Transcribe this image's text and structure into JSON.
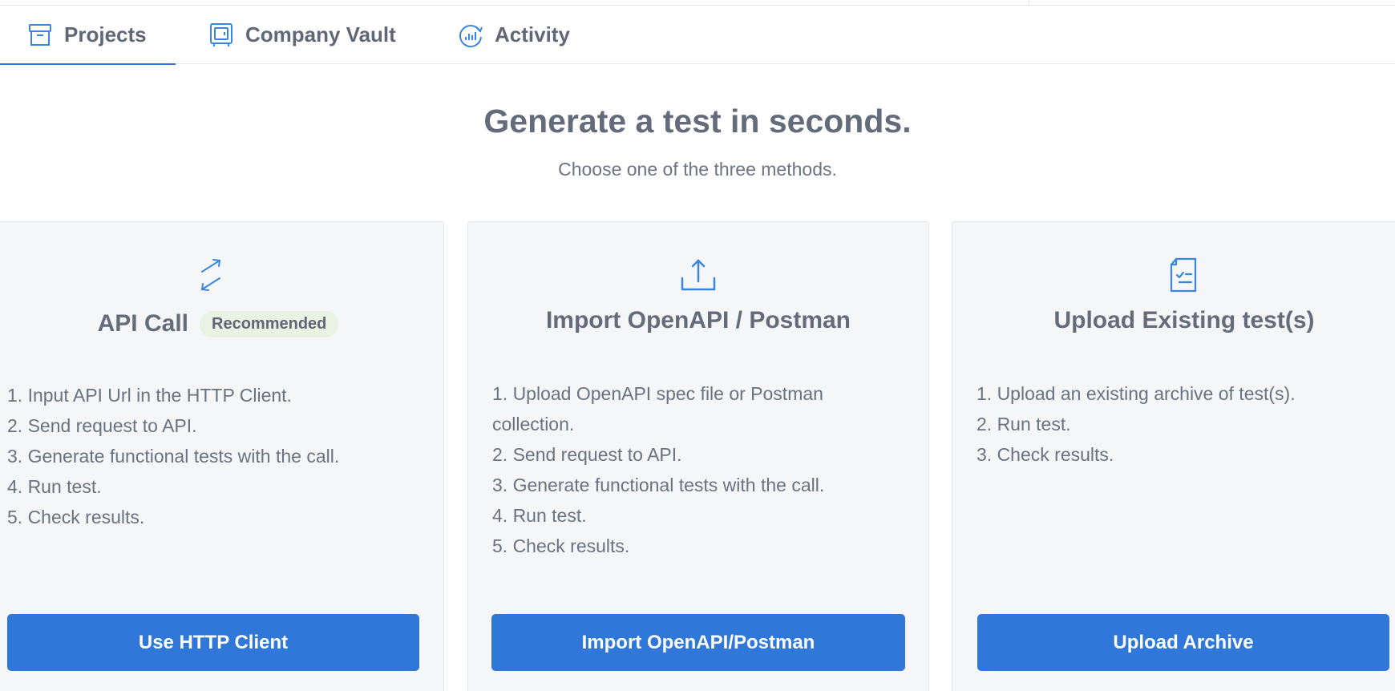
{
  "tabs": [
    {
      "label": "Projects",
      "icon": "archive-box-icon",
      "active": true
    },
    {
      "label": "Company Vault",
      "icon": "vault-icon",
      "active": false
    },
    {
      "label": "Activity",
      "icon": "activity-chart-icon",
      "active": false
    }
  ],
  "hero": {
    "title": "Generate a test in seconds.",
    "subtitle": "Choose one of the three methods."
  },
  "cards": [
    {
      "icon": "arrows-diagonal-icon",
      "title": "API Call",
      "badge": "Recommended",
      "steps": [
        "1. Input API Url in the HTTP Client.",
        "2. Send request to API.",
        "3. Generate functional tests with the call.",
        "4. Run test.",
        "5. Check results."
      ],
      "button": "Use HTTP Client"
    },
    {
      "icon": "upload-icon",
      "title": "Import OpenAPI / Postman",
      "steps": [
        "1. Upload OpenAPI spec file or Postman",
        "collection.",
        "2. Send request to API.",
        "3. Generate functional tests with the call.",
        "4. Run test.",
        "5. Check results."
      ],
      "button": "Import OpenAPI/Postman"
    },
    {
      "icon": "checklist-document-icon",
      "title": "Upload Existing test(s)",
      "steps": [
        "1. Upload an existing archive of test(s).",
        "2. Run test.",
        "3. Check results."
      ],
      "button": "Upload Archive"
    }
  ],
  "colors": {
    "accent": "#2f78d9",
    "card_bg": "#f5f6f8",
    "badge_bg": "#e8f3e4",
    "text": "#646b7a"
  }
}
